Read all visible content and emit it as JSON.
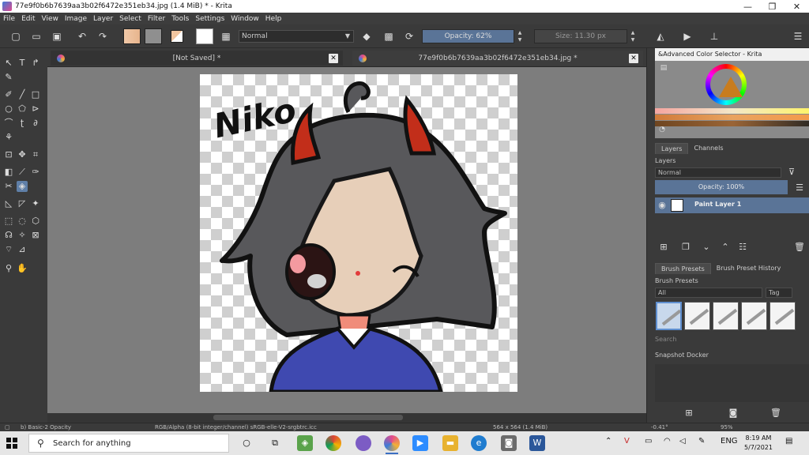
{
  "window": {
    "title": "77e9f0b6b7639aa3b02f6472e351eb34.jpg (1.4 MiB)  * - Krita",
    "minimize": "—",
    "restore": "❐",
    "close": "✕"
  },
  "menu": [
    "File",
    "Edit",
    "View",
    "Image",
    "Layer",
    "Select",
    "Filter",
    "Tools",
    "Settings",
    "Window",
    "Help"
  ],
  "toolbar": {
    "blend_mode": "Normal",
    "opacity": "Opacity:  62%",
    "size": "Size:  11.30 px"
  },
  "tabs": [
    {
      "label": "[Not Saved]  *",
      "close": "✕"
    },
    {
      "label": "77e9f0b6b7639aa3b02f6472e351eb34.jpg  *",
      "close": "✕"
    }
  ],
  "artwork": {
    "signature": "Niko"
  },
  "color_selector": {
    "title": "&Advanced Color Selector - Krita"
  },
  "layers_panel": {
    "tabs": [
      "Layers",
      "Channels"
    ],
    "title": "Layers",
    "blend_mode": "Normal",
    "opacity": "Opacity:  100%",
    "layer_name": "Paint Layer 1"
  },
  "brush_panel": {
    "tabs": [
      "Brush Presets",
      "Brush Preset History"
    ],
    "title": "Brush Presets",
    "filter": "All",
    "tag": "Tag",
    "search_placeholder": "Search"
  },
  "snapshot": {
    "title": "Snapshot Docker"
  },
  "statusbar": {
    "brush": "b) Basic-2 Opacity",
    "colorspace": "RGB/Alpha (8-bit integer/channel)  sRGB-elle-V2-srgbtrc.icc",
    "dimensions": "564 x 564 (1.4 MiB)",
    "rotation": "-0.41°",
    "zoom": "95%"
  },
  "taskbar": {
    "search_placeholder": "Search for anything",
    "lang": "ENG",
    "time": "8:19 AM",
    "date": "5/7/2021"
  },
  "colors": {
    "accent": "#5a7497",
    "canvas_bg": "#7d7d7d",
    "chrome": "#3a3a3a",
    "hair": "#58585b",
    "horns": "#c22e1a",
    "jacket": "#3f49b0",
    "skin": "#f7dcc4"
  }
}
